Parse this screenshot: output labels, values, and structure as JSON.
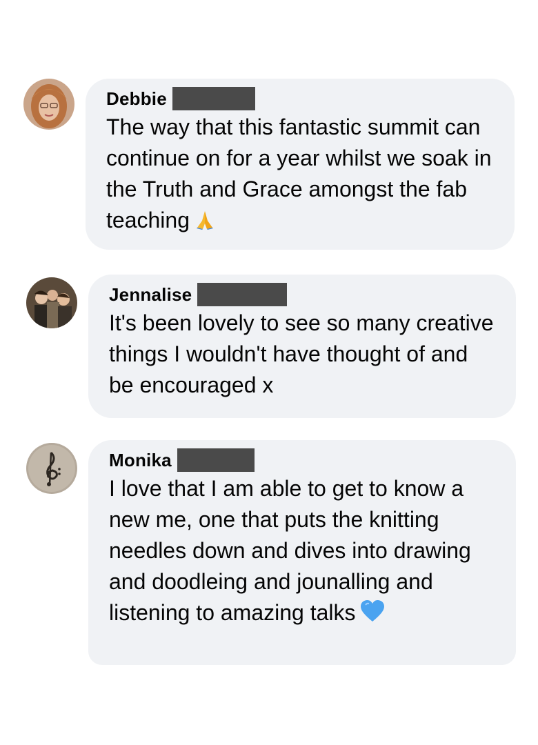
{
  "comments": [
    {
      "author": "Debbie",
      "text": "The way that this fantastic summit can continue on for a year whilst we soak in the Truth and Grace amongst the fab teaching",
      "emoji": "folded-hands-icon"
    },
    {
      "author": "Jennalise",
      "text": "It's been lovely to see so many creative things I wouldn't have thought of and be encouraged x",
      "emoji": ""
    },
    {
      "author": "Monika",
      "text": "I love that I am able to get to know a new me, one that puts the knitting needles down and dives into drawing and doodleing and jounalling and listening to amazing talks",
      "emoji": "blue-heart-icon"
    }
  ],
  "colors": {
    "bubble": "#f0f2f5",
    "text": "#050505",
    "redaction": "#4a4a4a",
    "heart": "#4aa3f0",
    "hands": "#f5b82e"
  }
}
